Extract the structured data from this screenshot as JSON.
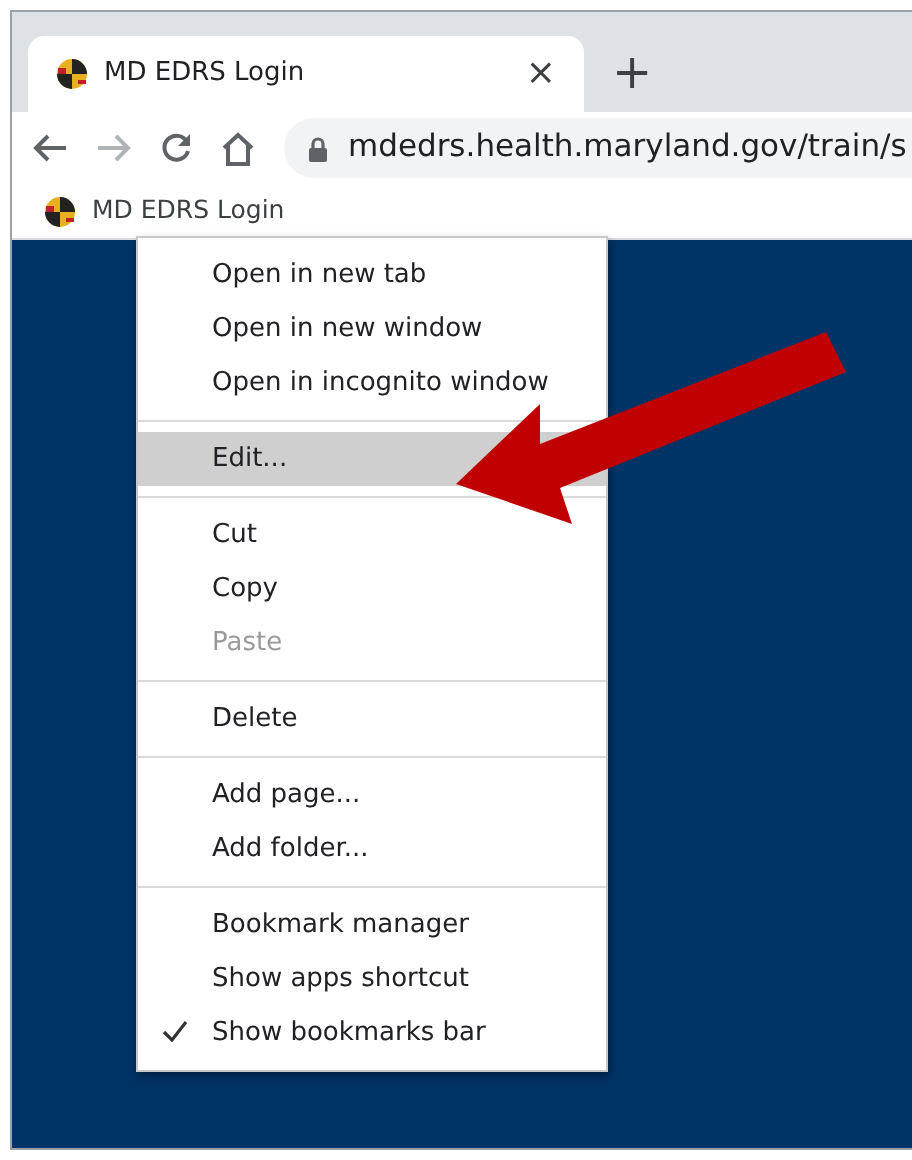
{
  "tab": {
    "title": "MD EDRS Login",
    "close": "×",
    "new_tab": "+"
  },
  "toolbar": {
    "url": "mdedrs.health.maryland.gov/train/s"
  },
  "bookmarks_bar": {
    "items": [
      {
        "label": "MD EDRS Login"
      }
    ]
  },
  "context_menu": {
    "items": [
      {
        "kind": "item",
        "label": "Open in new tab",
        "selected": false,
        "disabled": false,
        "checked": false
      },
      {
        "kind": "item",
        "label": "Open in new window",
        "selected": false,
        "disabled": false,
        "checked": false
      },
      {
        "kind": "item",
        "label": "Open in incognito window",
        "selected": false,
        "disabled": false,
        "checked": false
      },
      {
        "kind": "separator"
      },
      {
        "kind": "item",
        "label": "Edit...",
        "selected": true,
        "disabled": false,
        "checked": false
      },
      {
        "kind": "separator"
      },
      {
        "kind": "item",
        "label": "Cut",
        "selected": false,
        "disabled": false,
        "checked": false
      },
      {
        "kind": "item",
        "label": "Copy",
        "selected": false,
        "disabled": false,
        "checked": false
      },
      {
        "kind": "item",
        "label": "Paste",
        "selected": false,
        "disabled": true,
        "checked": false
      },
      {
        "kind": "separator"
      },
      {
        "kind": "item",
        "label": "Delete",
        "selected": false,
        "disabled": false,
        "checked": false
      },
      {
        "kind": "separator"
      },
      {
        "kind": "item",
        "label": "Add page...",
        "selected": false,
        "disabled": false,
        "checked": false
      },
      {
        "kind": "item",
        "label": "Add folder...",
        "selected": false,
        "disabled": false,
        "checked": false
      },
      {
        "kind": "separator"
      },
      {
        "kind": "item",
        "label": "Bookmark manager",
        "selected": false,
        "disabled": false,
        "checked": false
      },
      {
        "kind": "item",
        "label": "Show apps shortcut",
        "selected": false,
        "disabled": false,
        "checked": false
      },
      {
        "kind": "item",
        "label": "Show bookmarks bar",
        "selected": false,
        "disabled": false,
        "checked": true
      }
    ]
  }
}
